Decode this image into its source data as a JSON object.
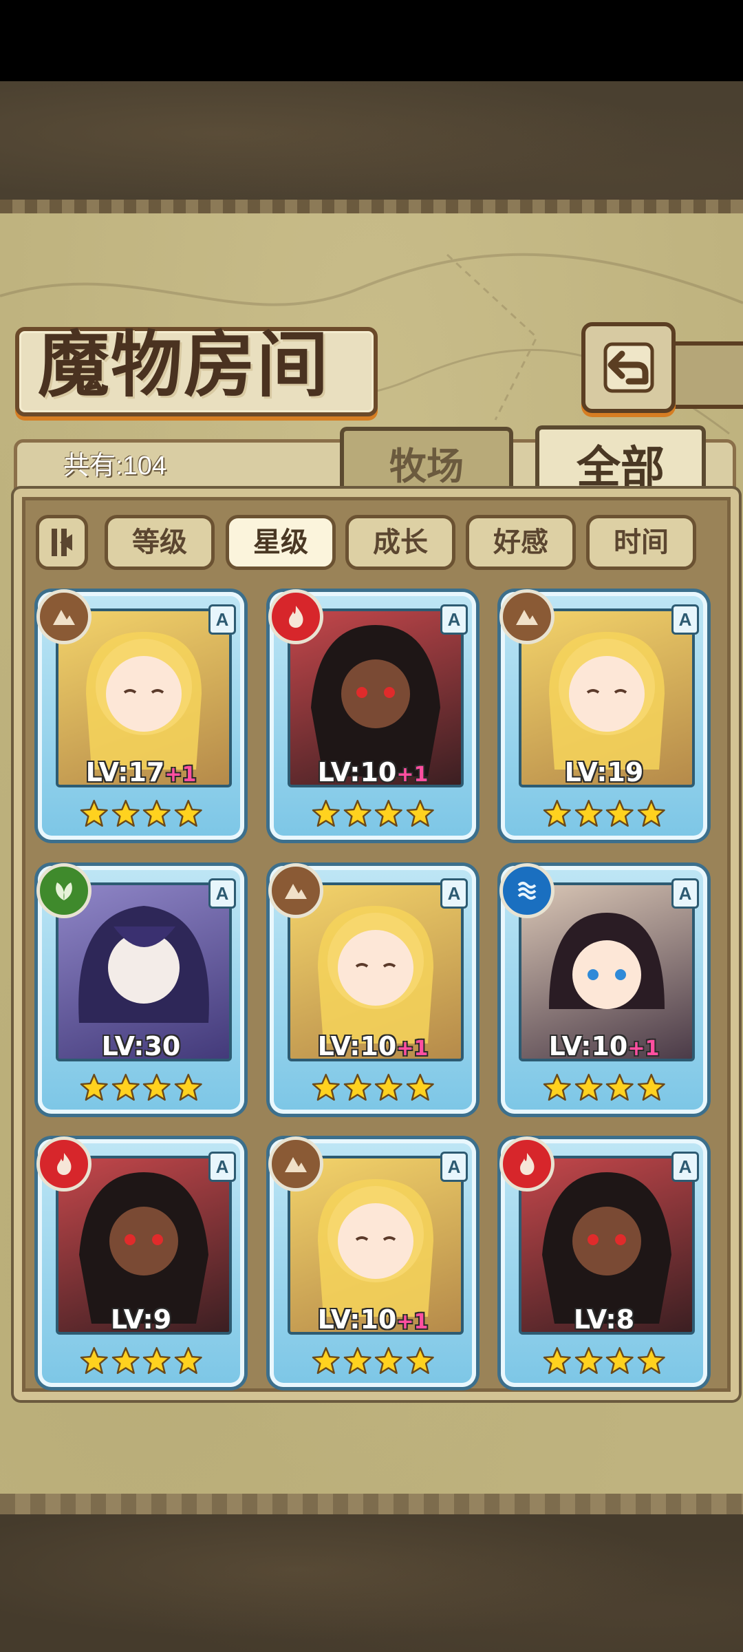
{
  "header": {
    "title": "魔物房间",
    "back_button": "back-arrow-icon"
  },
  "summary": {
    "count_label": "共有:104"
  },
  "tabs": [
    {
      "label": "牧场",
      "active": false
    },
    {
      "label": "全部",
      "active": true
    }
  ],
  "filters": {
    "sort_toggle_icon": "sort-direction-icon",
    "options": [
      {
        "label": "等级",
        "active": false
      },
      {
        "label": "星级",
        "active": true
      },
      {
        "label": "成长",
        "active": false
      },
      {
        "label": "好感",
        "active": false
      },
      {
        "label": "时间",
        "active": false
      }
    ]
  },
  "colors": {
    "fire": "#d7262b",
    "earth": "#8a5a35",
    "nature": "#3f8a2c",
    "water": "#1a6fc0"
  },
  "monsters": [
    {
      "element": "earth",
      "rarity": "A",
      "level": "LV:17",
      "bonus": "+1",
      "stars": 4
    },
    {
      "element": "fire",
      "rarity": "A",
      "level": "LV:10",
      "bonus": "+1",
      "stars": 4
    },
    {
      "element": "earth",
      "rarity": "A",
      "level": "LV:19",
      "bonus": "",
      "stars": 4
    },
    {
      "element": "nature",
      "rarity": "A",
      "level": "LV:30",
      "bonus": "",
      "stars": 4
    },
    {
      "element": "earth",
      "rarity": "A",
      "level": "LV:10",
      "bonus": "+1",
      "stars": 4
    },
    {
      "element": "water",
      "rarity": "A",
      "level": "LV:10",
      "bonus": "+1",
      "stars": 4
    },
    {
      "element": "fire",
      "rarity": "A",
      "level": "LV:9",
      "bonus": "",
      "stars": 4
    },
    {
      "element": "earth",
      "rarity": "A",
      "level": "LV:10",
      "bonus": "+1",
      "stars": 4
    },
    {
      "element": "fire",
      "rarity": "A",
      "level": "LV:8",
      "bonus": "",
      "stars": 4
    }
  ]
}
